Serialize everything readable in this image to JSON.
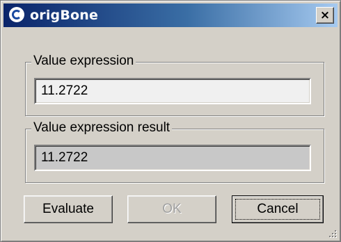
{
  "window": {
    "title": "origBone",
    "close_label": "×",
    "icon": "app-logo-icon"
  },
  "value_expression": {
    "label": "Value expression",
    "value": "11.2722"
  },
  "value_result": {
    "label": "Value expression result",
    "value": "11.2722"
  },
  "buttons": {
    "evaluate": "Evaluate",
    "ok": "OK",
    "cancel": "Cancel"
  }
}
